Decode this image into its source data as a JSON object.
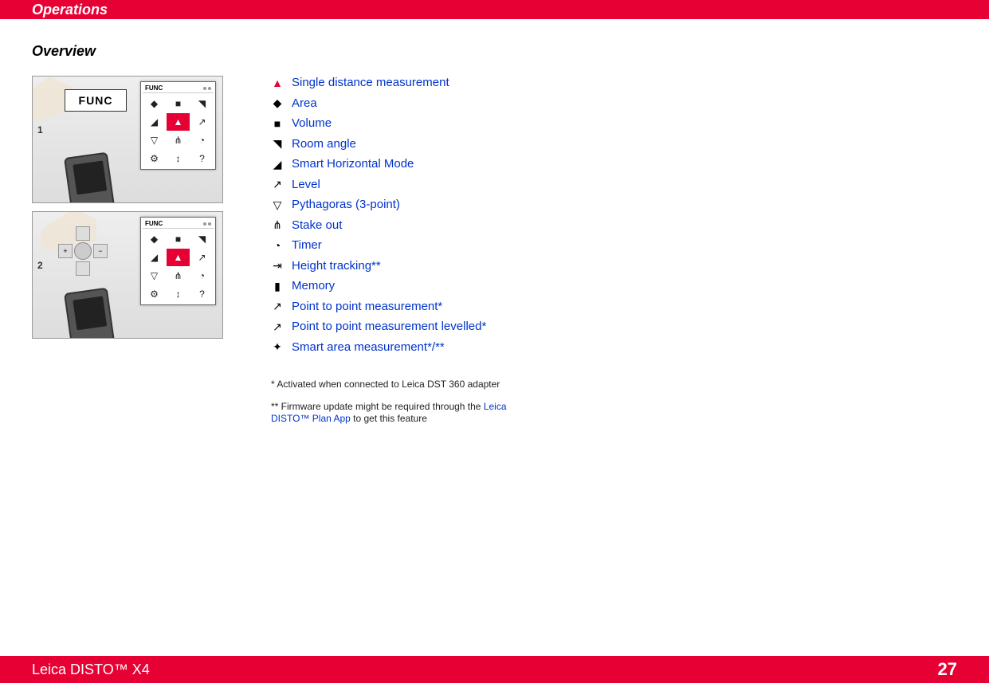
{
  "header": {
    "title": "Operations"
  },
  "section_title": "Overview",
  "illustrations": [
    {
      "step": "1",
      "key_label": "FUNC",
      "screen_header": "FUNC"
    },
    {
      "step": "2",
      "key_label": "",
      "screen_header": "FUNC"
    }
  ],
  "screen_grid_icons": [
    "◆",
    "■",
    "◥",
    "◢",
    "▲",
    "↗",
    "▽",
    "⋔",
    "◔",
    "⚙",
    "↕",
    "?"
  ],
  "functions": [
    {
      "icon": "▲",
      "label": "Single distance measurement"
    },
    {
      "icon": "◆",
      "label": "Area"
    },
    {
      "icon": "■",
      "label": "Volume"
    },
    {
      "icon": "◥",
      "label": "Room angle"
    },
    {
      "icon": "◢",
      "label": "Smart Horizontal Mode"
    },
    {
      "icon": "↗",
      "label": "Level"
    },
    {
      "icon": "▽",
      "label": "Pythagoras (3-point)"
    },
    {
      "icon": "⋔",
      "label": "Stake out"
    },
    {
      "icon": "◔",
      "label": "Timer"
    },
    {
      "icon": "⇥",
      "label": "Height tracking**"
    },
    {
      "icon": "▮",
      "label": "Memory"
    },
    {
      "icon": "↗",
      "label": "Point to point measurement*"
    },
    {
      "icon": "↗",
      "label": "Point to point measurement levelled*"
    },
    {
      "icon": "✦",
      "label": "Smart area measurement*/**"
    }
  ],
  "footnotes": {
    "note1": "* Activated when connected to Leica DST 360 adapter",
    "note2_pre": "** Firmware update might be required through the ",
    "note2_link": "Leica DISTO™ Plan App",
    "note2_post": " to get this feature"
  },
  "footer": {
    "product": "Leica DISTO™ X4",
    "page": "27"
  },
  "dpad": {
    "up": "",
    "down": "",
    "left": "+",
    "right": "−",
    "center": ""
  }
}
